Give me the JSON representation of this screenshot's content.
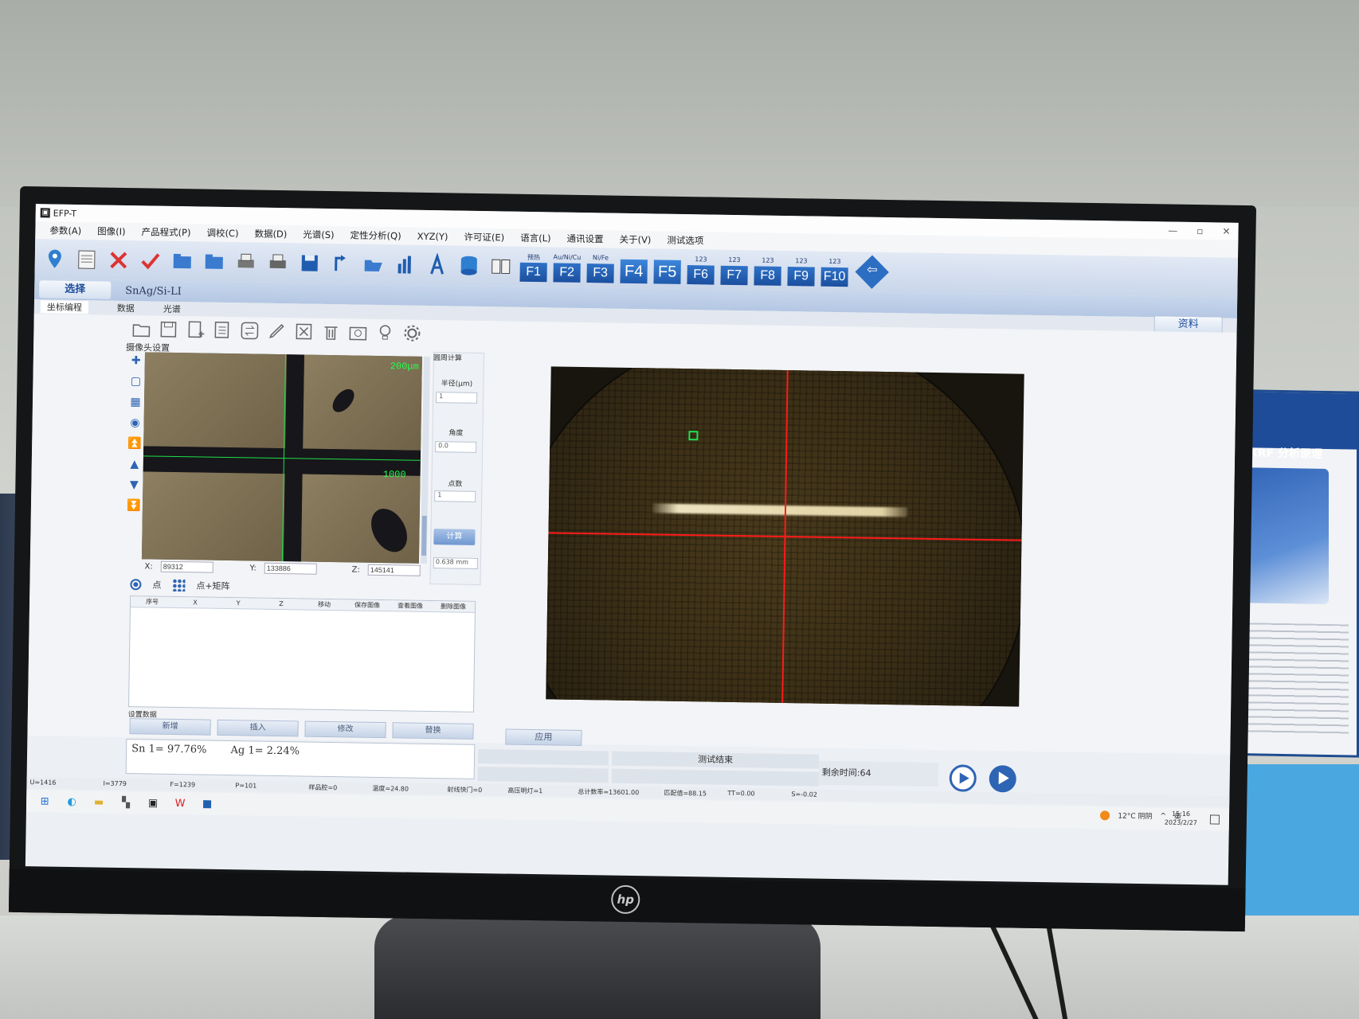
{
  "window": {
    "title": "EFP-T",
    "controls": [
      "—",
      "▫",
      "✕"
    ]
  },
  "menu": [
    "参数(A)",
    "图像(I)",
    "产品程式(P)",
    "调校(C)",
    "数据(D)",
    "光谱(S)",
    "定性分析(Q)",
    "XYZ(Y)",
    "许可证(E)",
    "语言(L)",
    "通讯设置",
    "关于(V)",
    "测试选项"
  ],
  "function_keys": [
    {
      "caption": "预热",
      "label": "F1"
    },
    {
      "caption": "Au/Ni/Cu",
      "label": "F2"
    },
    {
      "caption": "Ni/Fe",
      "label": "F3"
    },
    {
      "caption": "",
      "label": "F4"
    },
    {
      "caption": "",
      "label": "F5"
    },
    {
      "caption": "123",
      "label": "F6"
    },
    {
      "caption": "123",
      "label": "F7"
    },
    {
      "caption": "123",
      "label": "F8"
    },
    {
      "caption": "123",
      "label": "F9"
    },
    {
      "caption": "123",
      "label": "F10"
    }
  ],
  "ribbon": {
    "select_tab": "选择",
    "material": "SnAg/Si-LI"
  },
  "subtabs": [
    "坐标编程",
    "数据",
    "光谱"
  ],
  "ziliao": "资料",
  "camera": {
    "section_label": "摄像头设置",
    "scale_top": "200μm",
    "scale_bottom": "1000",
    "x_label": "X:",
    "x_value": "89312",
    "y_label": "Y:",
    "y_value": "133886",
    "z_label": "Z:",
    "z_value": "145141"
  },
  "circle_calc": {
    "title": "圆周计算",
    "radius_label": "半径(μm)",
    "radius_value": "1",
    "angle_label": "角度",
    "angle_value": "0.0",
    "points_label": "点数",
    "points_value": "1",
    "calc_button": "计算",
    "output": "0.638 mm"
  },
  "mode": {
    "point": "点",
    "point_matrix": "点+矩阵"
  },
  "table_headers": [
    "序号",
    "X",
    "Y",
    "Z",
    "移动",
    "保存图像",
    "查看图像",
    "删除图像"
  ],
  "set_data_label": "设置数据",
  "actions": [
    "新增",
    "插入",
    "修改",
    "替换"
  ],
  "apply": "应用",
  "results": {
    "sn": "Sn  1=  97.76%",
    "ag": "Ag  1=  2.24%"
  },
  "status": {
    "test_end": "测试结束",
    "remaining": "剩余时间:64"
  },
  "statusbar": [
    "U=1416",
    "I=3779",
    "F=1239",
    "P=101",
    "样品腔=0",
    "温度=24.80",
    "射线快门=0",
    "高压明灯=1",
    "总计数率=13601.00",
    "匹配值=88.15",
    "TT=0.00",
    "S=-0.02"
  ],
  "taskbar": {
    "weather": "12°C  阴阴",
    "lang": "英",
    "time": "15:16",
    "date": "2023/2/27"
  },
  "poster": {
    "title": "XRF 分析原理"
  },
  "brand": "hp"
}
